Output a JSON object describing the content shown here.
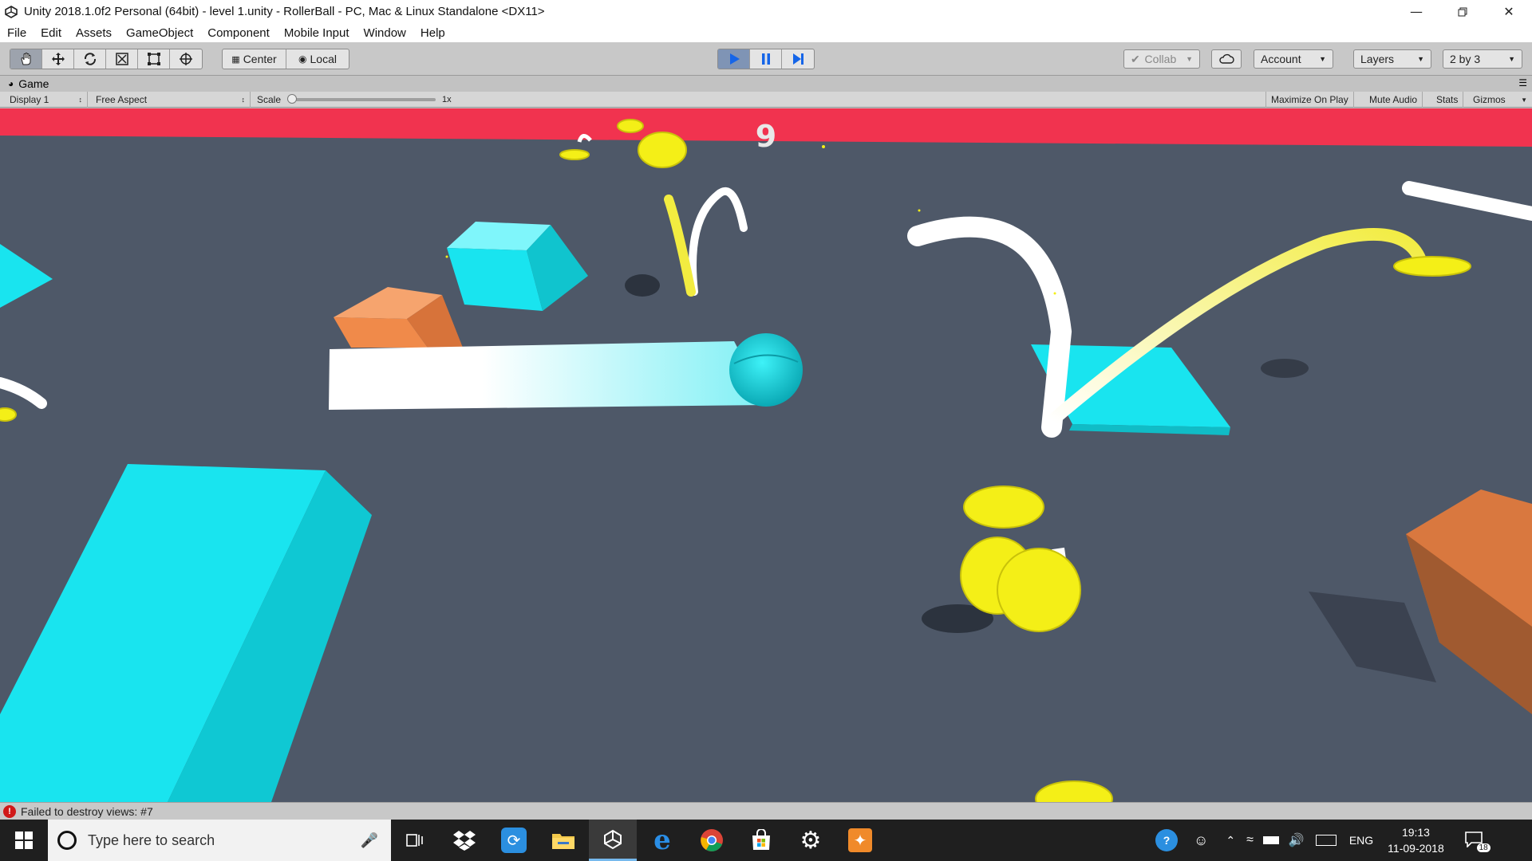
{
  "window": {
    "title": "Unity 2018.1.0f2 Personal (64bit) - level 1.unity - RollerBall - PC, Mac & Linux Standalone <DX11>",
    "minimize_icon": "minimize-icon",
    "restore_icon": "restore-icon",
    "close_icon": "close-icon"
  },
  "menu": [
    "File",
    "Edit",
    "Assets",
    "GameObject",
    "Component",
    "Mobile Input",
    "Window",
    "Help"
  ],
  "toolbar": {
    "tools": [
      "hand-tool-icon",
      "move-tool-icon",
      "rotate-tool-icon",
      "scale-tool-icon",
      "rect-tool-icon",
      "transform-tool-icon"
    ],
    "pivot_label": "Center",
    "space_label": "Local",
    "play_icon": "play-icon",
    "pause_icon": "pause-icon",
    "step_icon": "step-icon",
    "collab_label": "Collab",
    "cloud_icon": "cloud-icon",
    "account_label": "Account",
    "layers_label": "Layers",
    "layout_label": "2 by 3"
  },
  "game_panel": {
    "tab_label": "Game",
    "display": "Display 1",
    "aspect": "Free Aspect",
    "scale_label": "Scale",
    "scale_value": "1x",
    "scale_level": 0,
    "maximize_label": "Maximize On Play",
    "mute_label": "Mute Audio",
    "stats_label": "Stats",
    "gizmos_label": "Gizmos"
  },
  "hud": {
    "score": "9"
  },
  "status": {
    "message": "Failed to destroy views: #7"
  },
  "taskbar": {
    "search_placeholder": "Type here to search",
    "apps": [
      "task-view-icon",
      "dropbox-icon",
      "sync-app-icon",
      "file-explorer-icon",
      "unity-icon",
      "edge-icon",
      "chrome-icon",
      "store-icon",
      "settings-icon",
      "game-app-icon"
    ],
    "language": "ENG",
    "time": "19:13",
    "date": "11-09-2018",
    "notification_count": "18"
  },
  "colors": {
    "hud_bar": "#f1334f",
    "floor": "#4e5868",
    "cyan": "#19e4ef",
    "orange": "#f08a4a",
    "coin": "#f4ef17"
  }
}
